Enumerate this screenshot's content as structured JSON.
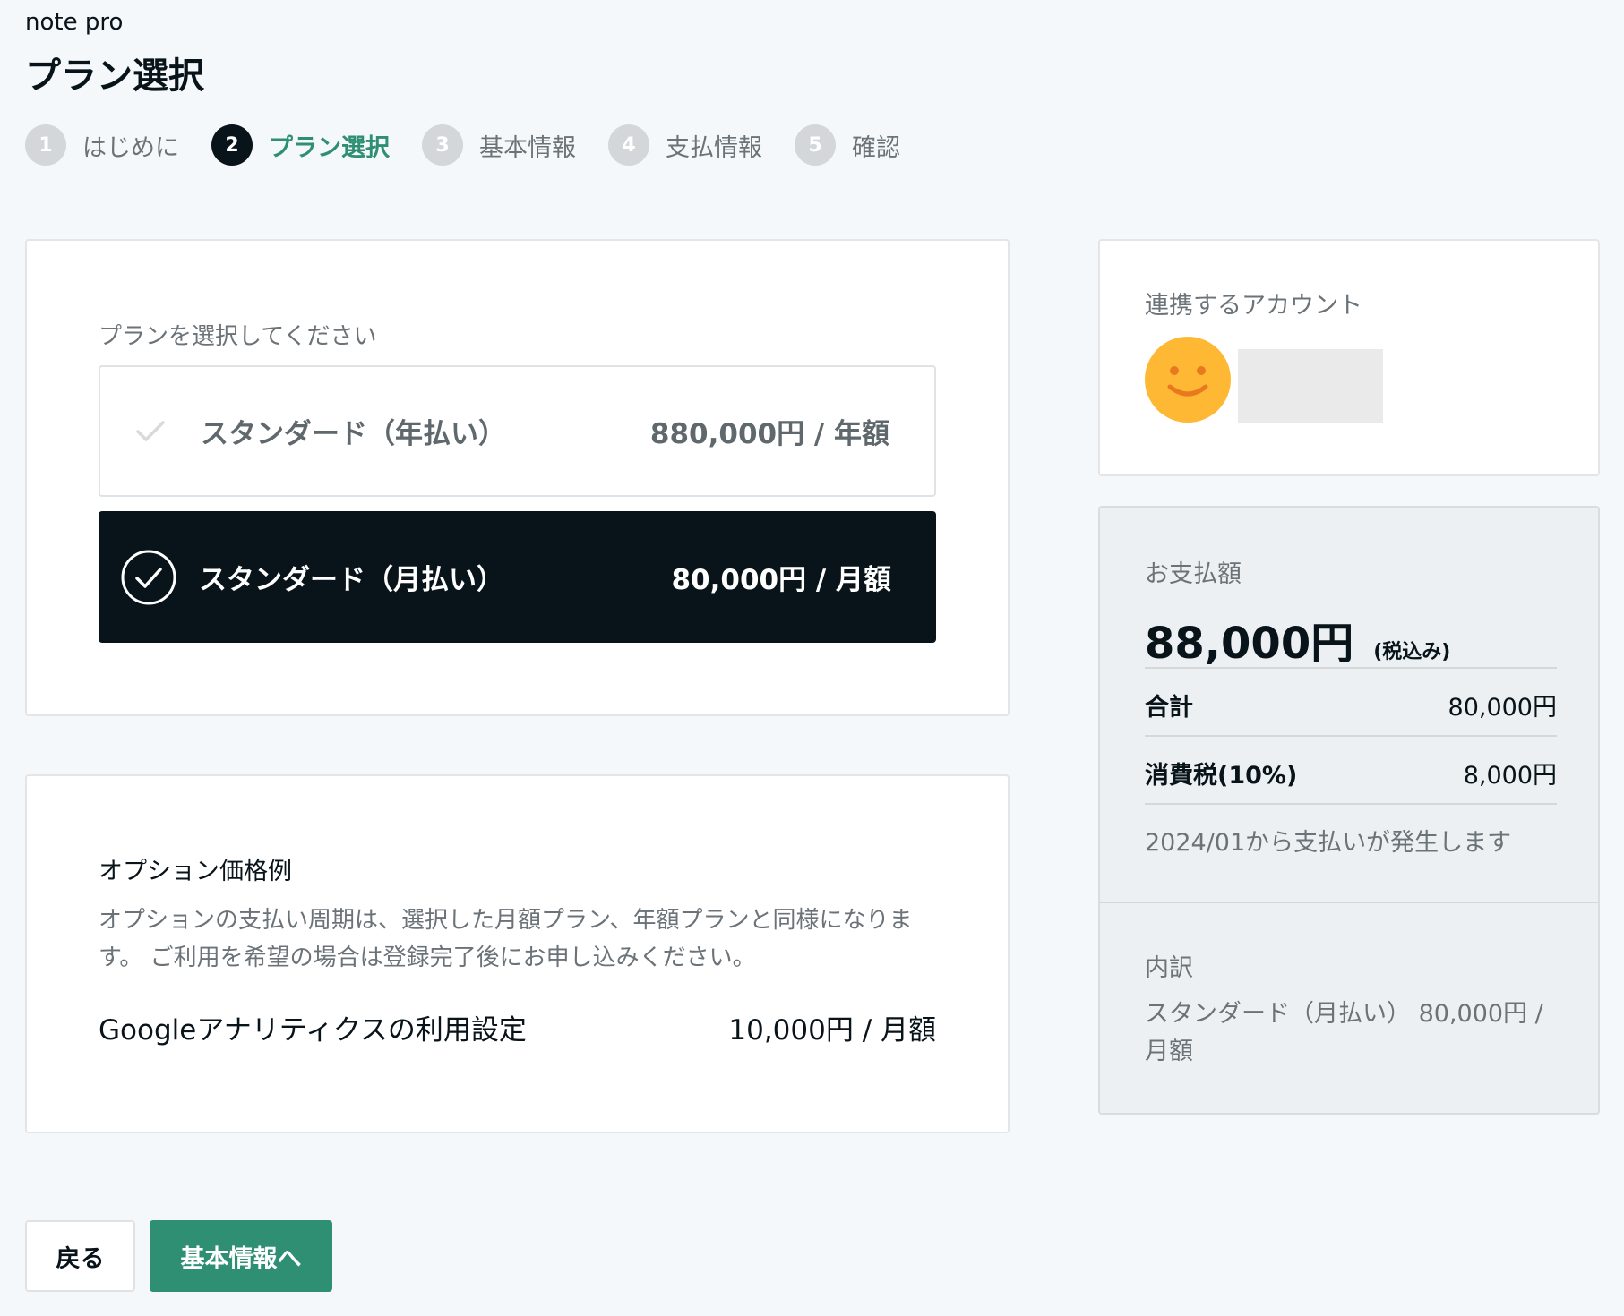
{
  "header": {
    "brand": "note pro",
    "title": "プラン選択"
  },
  "steps": [
    {
      "num": "1",
      "label": "はじめに",
      "active": false
    },
    {
      "num": "2",
      "label": "プラン選択",
      "active": true
    },
    {
      "num": "3",
      "label": "基本情報",
      "active": false
    },
    {
      "num": "4",
      "label": "支払情報",
      "active": false
    },
    {
      "num": "5",
      "label": "確認",
      "active": false
    }
  ],
  "plan": {
    "prompt": "プランを選択してください",
    "options": [
      {
        "name": "スタンダード（年払い）",
        "price": "880,000円 / 年額",
        "selected": false
      },
      {
        "name": "スタンダード（月払い）",
        "price": "80,000円 / 月額",
        "selected": true
      }
    ]
  },
  "option_pricing": {
    "title": "オプション価格例",
    "description": "オプションの支払い周期は、選択した月額プラン、年額プランと同様になります。 ご利用を希望の場合は登録完了後にお申し込みください。",
    "item_name": "Googleアナリティクスの利用設定",
    "item_price": "10,000円 / 月額"
  },
  "account": {
    "title": "連携するアカウント"
  },
  "payment": {
    "label": "お支払額",
    "amount": "88,000円",
    "tax_note": "(税込み)",
    "subtotal_label": "合計",
    "subtotal_value": "80,000円",
    "tax_label": "消費税(10%)",
    "tax_value": "8,000円",
    "start_note": "2024/01から支払いが発生します",
    "breakdown_title": "内訳",
    "breakdown_text": "スタンダード（月払い） 80,000円 / 月額"
  },
  "buttons": {
    "back": "戻る",
    "next": "基本情報へ"
  },
  "colors": {
    "accent": "#2e8f73",
    "dark": "#08131a",
    "avatar": "#ffb833"
  }
}
